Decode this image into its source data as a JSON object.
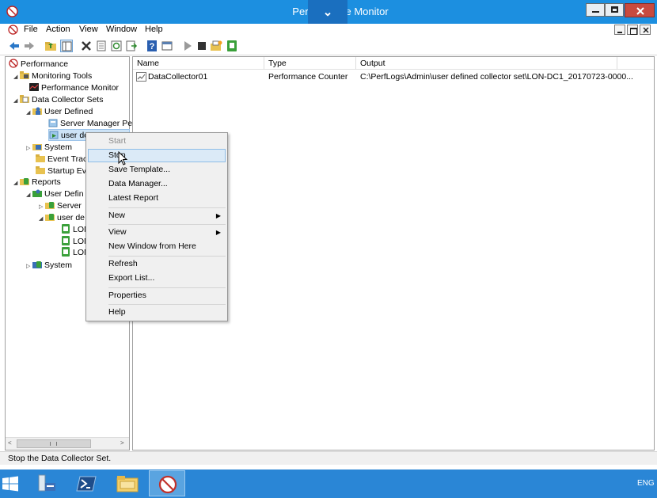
{
  "window": {
    "title": "Performance Monitor",
    "top_overlay_icon": "chevron-down-icon"
  },
  "menu": {
    "items": [
      "File",
      "Action",
      "View",
      "Window",
      "Help"
    ]
  },
  "tree": {
    "items": [
      {
        "label": "Performance",
        "icon": "performance-icon"
      },
      {
        "label": "Monitoring Tools",
        "icon": "folder-icon"
      },
      {
        "label": "Performance Monitor",
        "icon": "chart-icon"
      },
      {
        "label": "Data Collector Sets",
        "icon": "folder-icon"
      },
      {
        "label": "User Defined",
        "icon": "user-folder-icon"
      },
      {
        "label": "Server Manager Per",
        "icon": "collector-set-icon"
      },
      {
        "label": "user de",
        "icon": "collector-set-running-icon"
      },
      {
        "label": "System",
        "icon": "folder-icon"
      },
      {
        "label": "Event Trac",
        "icon": "folder-icon"
      },
      {
        "label": "Startup Eve",
        "icon": "folder-icon"
      },
      {
        "label": "Reports",
        "icon": "report-folder-icon"
      },
      {
        "label": "User Defin",
        "icon": "user-folder-icon"
      },
      {
        "label": "Server",
        "icon": "report-folder-icon"
      },
      {
        "label": "user de",
        "icon": "report-folder-icon"
      },
      {
        "label": "LON",
        "icon": "report-icon"
      },
      {
        "label": "LON",
        "icon": "report-icon"
      },
      {
        "label": "LON",
        "icon": "report-icon"
      },
      {
        "label": "System",
        "icon": "report-folder-icon"
      }
    ]
  },
  "list": {
    "columns": [
      "Name",
      "Type",
      "Output"
    ],
    "rows": [
      {
        "name": "DataCollector01",
        "type": "Performance Counter",
        "output": "C:\\PerfLogs\\Admin\\user defined collector set\\LON-DC1_20170723-0000..."
      }
    ]
  },
  "context_menu": {
    "items": [
      {
        "label": "Start",
        "disabled": true
      },
      {
        "label": "Stop",
        "highlighted": true
      },
      {
        "label": "Save Template..."
      },
      {
        "label": "Data Manager..."
      },
      {
        "label": "Latest Report"
      },
      {
        "label": "New",
        "submenu": true
      },
      {
        "label": "View",
        "submenu": true
      },
      {
        "label": "New Window from Here"
      },
      {
        "label": "Refresh"
      },
      {
        "label": "Export List..."
      },
      {
        "label": "Properties"
      },
      {
        "label": "Help"
      }
    ]
  },
  "status": {
    "text": "Stop the Data Collector Set."
  },
  "taskbar": {
    "language": "ENG",
    "buttons": [
      "start-icon",
      "server-manager-icon",
      "powershell-icon",
      "file-explorer-icon",
      "performance-monitor-icon"
    ]
  },
  "colors": {
    "title_bar": "#1c8fe0",
    "taskbar": "#2a86d6",
    "highlight": "#dbeaf7"
  }
}
